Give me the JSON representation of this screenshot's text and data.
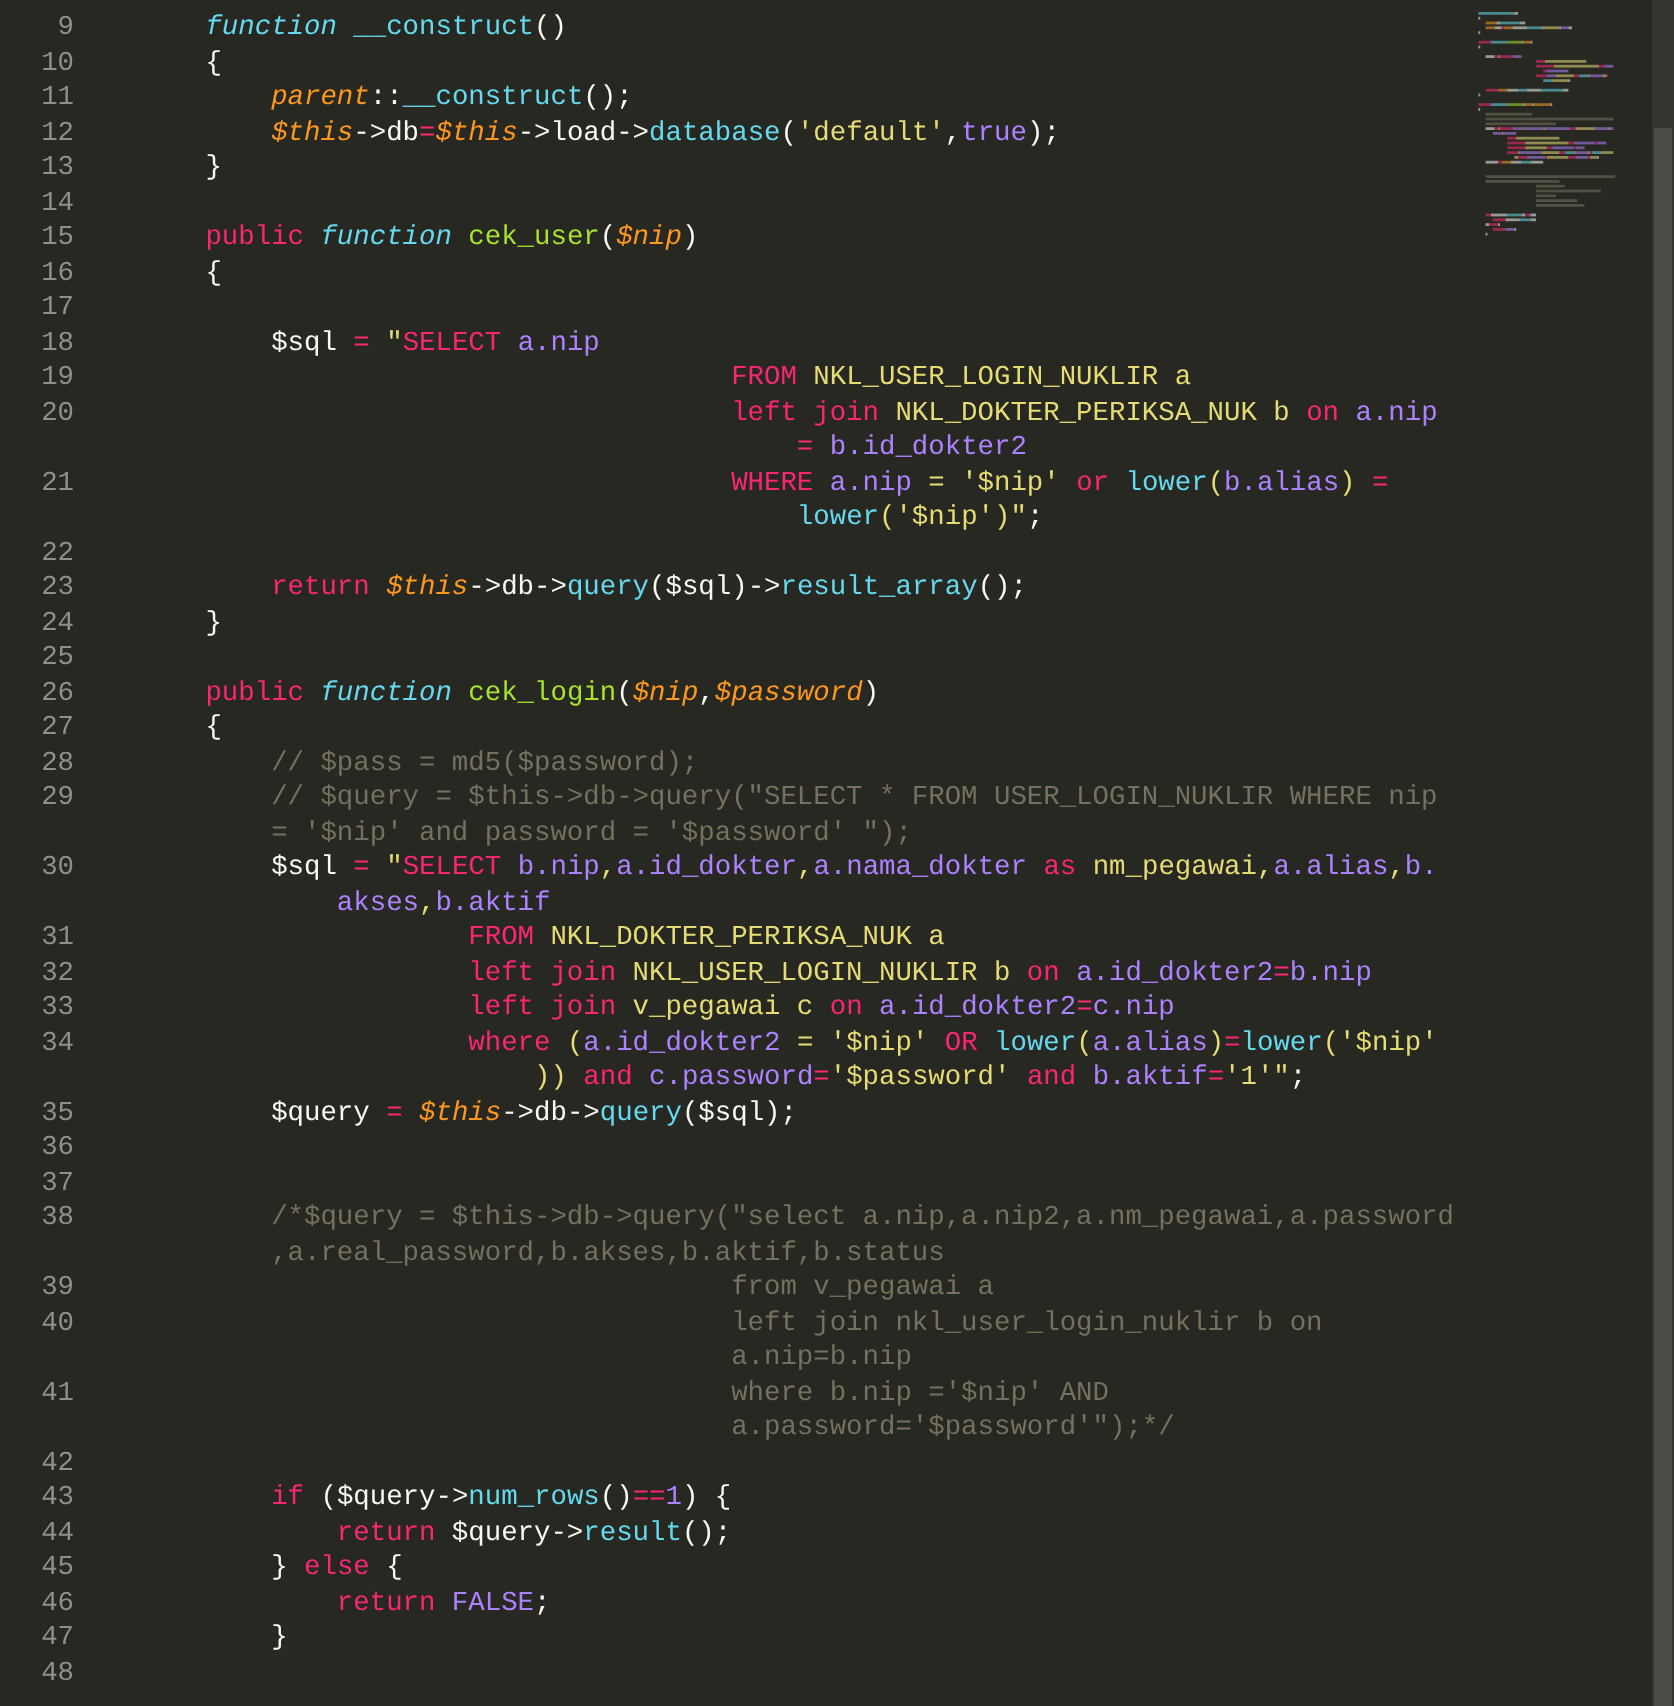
{
  "editor": {
    "lines": [
      {
        "number": "9",
        "rows": [
          {
            "tokens": [
              {
                "kind": "storage",
                "text": "        function "
              },
              {
                "kind": "support",
                "text": "__construct"
              },
              {
                "kind": "plain",
                "text": "()"
              }
            ]
          }
        ]
      },
      {
        "number": "10",
        "rows": [
          {
            "tokens": [
              {
                "kind": "plain",
                "text": "        {"
              }
            ]
          }
        ]
      },
      {
        "number": "11",
        "rows": [
          {
            "tokens": [
              {
                "kind": "variable",
                "text": "            parent"
              },
              {
                "kind": "plain",
                "text": "::"
              },
              {
                "kind": "support",
                "text": "__construct"
              },
              {
                "kind": "plain",
                "text": "();"
              }
            ]
          }
        ]
      },
      {
        "number": "12",
        "rows": [
          {
            "tokens": [
              {
                "kind": "variable",
                "text": "            $this"
              },
              {
                "kind": "plain",
                "text": "->db"
              },
              {
                "kind": "keyword",
                "text": "="
              },
              {
                "kind": "variable",
                "text": "$this"
              },
              {
                "kind": "plain",
                "text": "->load->"
              },
              {
                "kind": "support",
                "text": "database"
              },
              {
                "kind": "plain",
                "text": "("
              },
              {
                "kind": "string",
                "text": "'default'"
              },
              {
                "kind": "plain",
                "text": ","
              },
              {
                "kind": "constant",
                "text": "true"
              },
              {
                "kind": "plain",
                "text": ");"
              }
            ]
          }
        ]
      },
      {
        "number": "13",
        "rows": [
          {
            "tokens": [
              {
                "kind": "plain",
                "text": "        }"
              }
            ]
          }
        ]
      },
      {
        "number": "14"
      },
      {
        "number": "15",
        "rows": [
          {
            "tokens": [
              {
                "kind": "keyword",
                "text": "        public "
              },
              {
                "kind": "storage",
                "text": "function "
              },
              {
                "kind": "entity",
                "text": "cek_user"
              },
              {
                "kind": "plain",
                "text": "("
              },
              {
                "kind": "variable",
                "text": "$nip"
              },
              {
                "kind": "plain",
                "text": ")"
              }
            ]
          }
        ]
      },
      {
        "number": "16",
        "rows": [
          {
            "tokens": [
              {
                "kind": "plain",
                "text": "        {"
              }
            ]
          }
        ]
      },
      {
        "number": "17"
      },
      {
        "number": "18",
        "rows": [
          {
            "tokens": [
              {
                "kind": "plain",
                "text": "            $sql "
              },
              {
                "kind": "keyword",
                "text": "= "
              },
              {
                "kind": "string",
                "text": "\""
              },
              {
                "kind": "keyword",
                "text": "SELECT "
              },
              {
                "kind": "constant",
                "text": "a.nip"
              }
            ]
          }
        ]
      },
      {
        "number": "19",
        "rows": [
          {
            "tokens": [
              {
                "kind": "keyword",
                "text": "                                        FROM "
              },
              {
                "kind": "string",
                "text": "NKL_USER_LOGIN_NUKLIR a"
              }
            ]
          }
        ]
      },
      {
        "number": "20",
        "rows": [
          {
            "tokens": [
              {
                "kind": "keyword",
                "text": "                                        left join "
              },
              {
                "kind": "string",
                "text": "NKL_DOKTER_PERIKSA_NUK b "
              },
              {
                "kind": "keyword",
                "text": "on "
              },
              {
                "kind": "constant",
                "text": "a.nip"
              }
            ]
          },
          {
            "tokens": [
              {
                "kind": "keyword",
                "text": "                                            = "
              },
              {
                "kind": "constant",
                "text": "b.id_dokter2"
              }
            ]
          }
        ]
      },
      {
        "number": "21",
        "rows": [
          {
            "tokens": [
              {
                "kind": "keyword",
                "text": "                                        WHERE "
              },
              {
                "kind": "constant",
                "text": "a.nip"
              },
              {
                "kind": "string",
                "text": " = '$nip' "
              },
              {
                "kind": "keyword",
                "text": "or "
              },
              {
                "kind": "support",
                "text": "lower"
              },
              {
                "kind": "string",
                "text": "("
              },
              {
                "kind": "constant",
                "text": "b.alias"
              },
              {
                "kind": "string",
                "text": ") "
              },
              {
                "kind": "keyword",
                "text": "="
              }
            ]
          },
          {
            "tokens": [
              {
                "kind": "support",
                "text": "                                            lower"
              },
              {
                "kind": "string",
                "text": "('$nip')\""
              },
              {
                "kind": "plain",
                "text": ";"
              }
            ]
          }
        ]
      },
      {
        "number": "22"
      },
      {
        "number": "23",
        "rows": [
          {
            "tokens": [
              {
                "kind": "keyword",
                "text": "            return "
              },
              {
                "kind": "variable",
                "text": "$this"
              },
              {
                "kind": "plain",
                "text": "->db->"
              },
              {
                "kind": "support",
                "text": "query"
              },
              {
                "kind": "plain",
                "text": "($sql)->"
              },
              {
                "kind": "support",
                "text": "result_array"
              },
              {
                "kind": "plain",
                "text": "();"
              }
            ]
          }
        ]
      },
      {
        "number": "24",
        "rows": [
          {
            "tokens": [
              {
                "kind": "plain",
                "text": "        }"
              }
            ]
          }
        ]
      },
      {
        "number": "25"
      },
      {
        "number": "26",
        "rows": [
          {
            "tokens": [
              {
                "kind": "keyword",
                "text": "        public "
              },
              {
                "kind": "storage",
                "text": "function "
              },
              {
                "kind": "entity",
                "text": "cek_login"
              },
              {
                "kind": "plain",
                "text": "("
              },
              {
                "kind": "variable",
                "text": "$nip"
              },
              {
                "kind": "plain",
                "text": ","
              },
              {
                "kind": "variable",
                "text": "$password"
              },
              {
                "kind": "plain",
                "text": ")"
              }
            ]
          }
        ]
      },
      {
        "number": "27",
        "rows": [
          {
            "tokens": [
              {
                "kind": "plain",
                "text": "        {"
              }
            ]
          }
        ]
      },
      {
        "number": "28",
        "rows": [
          {
            "tokens": [
              {
                "kind": "comment",
                "text": "            // $pass = md5($password);"
              }
            ]
          }
        ]
      },
      {
        "number": "29",
        "rows": [
          {
            "tokens": [
              {
                "kind": "comment",
                "text": "            // $query = $this->db->query(\"SELECT * FROM USER_LOGIN_NUKLIR WHERE nip"
              }
            ]
          },
          {
            "tokens": [
              {
                "kind": "comment",
                "text": "            = '$nip' and password = '$password' \");"
              }
            ]
          }
        ]
      },
      {
        "number": "30",
        "rows": [
          {
            "tokens": [
              {
                "kind": "plain",
                "text": "            $sql "
              },
              {
                "kind": "keyword",
                "text": "= "
              },
              {
                "kind": "string",
                "text": "\""
              },
              {
                "kind": "keyword",
                "text": "SELECT "
              },
              {
                "kind": "constant",
                "text": "b.nip"
              },
              {
                "kind": "string",
                "text": ","
              },
              {
                "kind": "constant",
                "text": "a.id_dokter"
              },
              {
                "kind": "string",
                "text": ","
              },
              {
                "kind": "constant",
                "text": "a.nama_dokter "
              },
              {
                "kind": "keyword",
                "text": "as "
              },
              {
                "kind": "string",
                "text": "nm_pegawai,"
              },
              {
                "kind": "constant",
                "text": "a.alias"
              },
              {
                "kind": "string",
                "text": ","
              },
              {
                "kind": "constant",
                "text": "b."
              }
            ]
          },
          {
            "tokens": [
              {
                "kind": "constant",
                "text": "                akses"
              },
              {
                "kind": "string",
                "text": ","
              },
              {
                "kind": "constant",
                "text": "b.aktif"
              }
            ]
          }
        ]
      },
      {
        "number": "31",
        "rows": [
          {
            "tokens": [
              {
                "kind": "keyword",
                "text": "                        FROM "
              },
              {
                "kind": "string",
                "text": "NKL_DOKTER_PERIKSA_NUK a"
              }
            ]
          }
        ]
      },
      {
        "number": "32",
        "rows": [
          {
            "tokens": [
              {
                "kind": "keyword",
                "text": "                        left join "
              },
              {
                "kind": "string",
                "text": "NKL_USER_LOGIN_NUKLIR b "
              },
              {
                "kind": "keyword",
                "text": "on "
              },
              {
                "kind": "constant",
                "text": "a.id_dokter2"
              },
              {
                "kind": "keyword",
                "text": "="
              },
              {
                "kind": "constant",
                "text": "b.nip"
              }
            ]
          }
        ]
      },
      {
        "number": "33",
        "rows": [
          {
            "tokens": [
              {
                "kind": "keyword",
                "text": "                        left join "
              },
              {
                "kind": "string",
                "text": "v_pegawai c "
              },
              {
                "kind": "keyword",
                "text": "on "
              },
              {
                "kind": "constant",
                "text": "a.id_dokter2"
              },
              {
                "kind": "keyword",
                "text": "="
              },
              {
                "kind": "constant",
                "text": "c.nip"
              }
            ]
          }
        ]
      },
      {
        "number": "34",
        "rows": [
          {
            "tokens": [
              {
                "kind": "keyword",
                "text": "                        where "
              },
              {
                "kind": "string",
                "text": "("
              },
              {
                "kind": "constant",
                "text": "a.id_dokter2"
              },
              {
                "kind": "string",
                "text": " = '$nip' "
              },
              {
                "kind": "keyword",
                "text": "OR "
              },
              {
                "kind": "support",
                "text": "lower"
              },
              {
                "kind": "string",
                "text": "("
              },
              {
                "kind": "constant",
                "text": "a.alias"
              },
              {
                "kind": "string",
                "text": ")"
              },
              {
                "kind": "keyword",
                "text": "="
              },
              {
                "kind": "support",
                "text": "lower"
              },
              {
                "kind": "string",
                "text": "('$nip'"
              }
            ]
          },
          {
            "tokens": [
              {
                "kind": "string",
                "text": "                            ))"
              },
              {
                "kind": "keyword",
                "text": " and "
              },
              {
                "kind": "constant",
                "text": "c.password"
              },
              {
                "kind": "keyword",
                "text": "="
              },
              {
                "kind": "string",
                "text": "'$password' "
              },
              {
                "kind": "keyword",
                "text": "and "
              },
              {
                "kind": "constant",
                "text": "b.aktif"
              },
              {
                "kind": "keyword",
                "text": "="
              },
              {
                "kind": "string",
                "text": "'1'\""
              },
              {
                "kind": "plain",
                "text": ";"
              }
            ]
          }
        ]
      },
      {
        "number": "35",
        "rows": [
          {
            "tokens": [
              {
                "kind": "plain",
                "text": "            $query "
              },
              {
                "kind": "keyword",
                "text": "= "
              },
              {
                "kind": "variable",
                "text": "$this"
              },
              {
                "kind": "plain",
                "text": "->db->"
              },
              {
                "kind": "support",
                "text": "query"
              },
              {
                "kind": "plain",
                "text": "($sql);"
              }
            ]
          }
        ]
      },
      {
        "number": "36"
      },
      {
        "number": "37"
      },
      {
        "number": "38",
        "rows": [
          {
            "tokens": [
              {
                "kind": "comment",
                "text": "            /*$query = $this->db->query(\"select a.nip,a.nip2,a.nm_pegawai,a.password"
              }
            ]
          },
          {
            "tokens": [
              {
                "kind": "comment",
                "text": "            ,a.real_password,b.akses,b.aktif,b.status"
              }
            ]
          }
        ]
      },
      {
        "number": "39",
        "rows": [
          {
            "tokens": [
              {
                "kind": "comment",
                "text": "                                        from v_pegawai a"
              }
            ]
          }
        ]
      },
      {
        "number": "40",
        "rows": [
          {
            "tokens": [
              {
                "kind": "comment",
                "text": "                                        left join nkl_user_login_nuklir b on"
              }
            ]
          },
          {
            "tokens": [
              {
                "kind": "comment",
                "text": "                                        a.nip=b.nip"
              }
            ]
          }
        ]
      },
      {
        "number": "41",
        "rows": [
          {
            "tokens": [
              {
                "kind": "comment",
                "text": "                                        where b.nip ='$nip' AND"
              }
            ]
          },
          {
            "tokens": [
              {
                "kind": "comment",
                "text": "                                        a.password='$password'\");*/"
              }
            ]
          }
        ]
      },
      {
        "number": "42"
      },
      {
        "number": "43",
        "rows": [
          {
            "tokens": [
              {
                "kind": "keyword",
                "text": "            if "
              },
              {
                "kind": "plain",
                "text": "($query->"
              },
              {
                "kind": "support",
                "text": "num_rows"
              },
              {
                "kind": "plain",
                "text": "()"
              },
              {
                "kind": "keyword",
                "text": "=="
              },
              {
                "kind": "constant",
                "text": "1"
              },
              {
                "kind": "plain",
                "text": ") {"
              }
            ]
          }
        ]
      },
      {
        "number": "44",
        "rows": [
          {
            "tokens": [
              {
                "kind": "keyword",
                "text": "                return "
              },
              {
                "kind": "plain",
                "text": "$query->"
              },
              {
                "kind": "support",
                "text": "result"
              },
              {
                "kind": "plain",
                "text": "();"
              }
            ]
          }
        ]
      },
      {
        "number": "45",
        "rows": [
          {
            "tokens": [
              {
                "kind": "plain",
                "text": "            } "
              },
              {
                "kind": "keyword",
                "text": "else "
              },
              {
                "kind": "plain",
                "text": "{"
              }
            ]
          }
        ]
      },
      {
        "number": "46",
        "rows": [
          {
            "tokens": [
              {
                "kind": "keyword",
                "text": "                return "
              },
              {
                "kind": "constant",
                "text": "FALSE"
              },
              {
                "kind": "plain",
                "text": ";"
              }
            ]
          }
        ]
      },
      {
        "number": "47",
        "rows": [
          {
            "tokens": [
              {
                "kind": "plain",
                "text": "            }"
              }
            ]
          }
        ]
      },
      {
        "number": "48"
      }
    ]
  }
}
